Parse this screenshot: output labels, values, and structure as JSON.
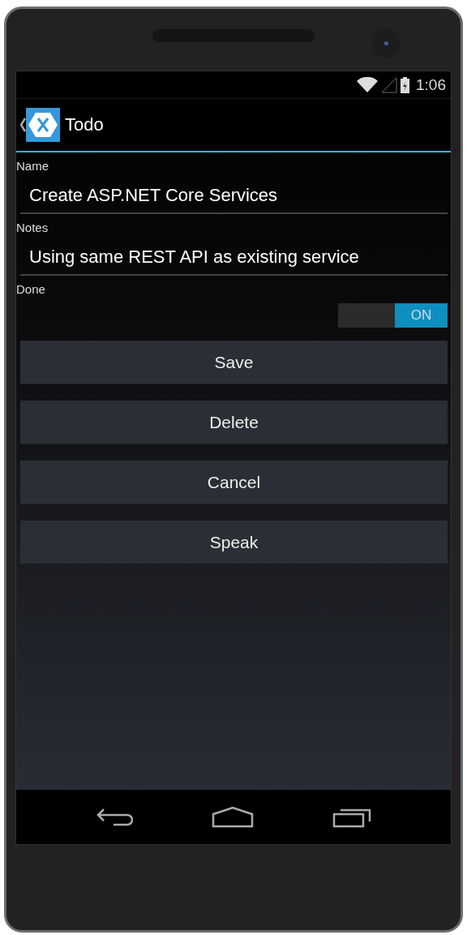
{
  "status_bar": {
    "time": "1:06"
  },
  "action_bar": {
    "title": "Todo"
  },
  "fields": [
    {
      "label": "Name",
      "value": "Create ASP.NET Core Services"
    },
    {
      "label": "Notes",
      "value": "Using same REST API as existing service"
    }
  ],
  "done": {
    "label": "Done",
    "on": true,
    "state_text": "ON"
  },
  "buttons": [
    "Save",
    "Delete",
    "Cancel",
    "Speak"
  ]
}
